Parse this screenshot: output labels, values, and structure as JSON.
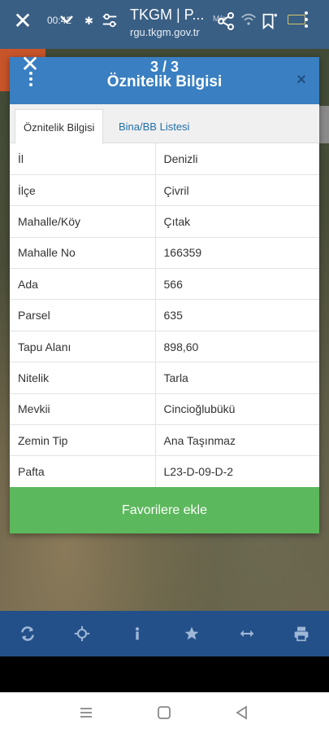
{
  "browser": {
    "title": "TKGM | P...",
    "url": "rgu.tkgm.gov.tr",
    "status_time": "00:42",
    "status_right": "M/s"
  },
  "dialog": {
    "counter": "3 / 3",
    "title": "Öznitelik Bilgisi",
    "close_symbol": "×",
    "tabs": [
      {
        "label": "Öznitelik Bilgisi",
        "active": true
      },
      {
        "label": "Bina/BB Listesi",
        "active": false
      }
    ],
    "rows": [
      {
        "key": "İl",
        "value": "Denizli"
      },
      {
        "key": "İlçe",
        "value": "Çivril"
      },
      {
        "key": "Mahalle/Köy",
        "value": "Çıtak"
      },
      {
        "key": "Mahalle No",
        "value": "166359"
      },
      {
        "key": "Ada",
        "value": "566"
      },
      {
        "key": "Parsel",
        "value": "635"
      },
      {
        "key": "Tapu Alanı",
        "value": "898,60"
      },
      {
        "key": "Nitelik",
        "value": "Tarla"
      },
      {
        "key": "Mevkii",
        "value": "Cincioğlubükü"
      },
      {
        "key": "Zemin Tip",
        "value": "Ana Taşınmaz"
      },
      {
        "key": "Pafta",
        "value": "L23-D-09-D-2"
      }
    ],
    "favorite_label": "Favorilere ekle"
  },
  "toolbar": {
    "icons": [
      "refresh-icon",
      "locate-icon",
      "info-icon",
      "star-icon",
      "measure-icon",
      "print-icon"
    ]
  },
  "colors": {
    "header": "#3a7fc1",
    "toolbar": "#24508a",
    "favorite": "#5cb85c",
    "link": "#1f6fa8"
  }
}
